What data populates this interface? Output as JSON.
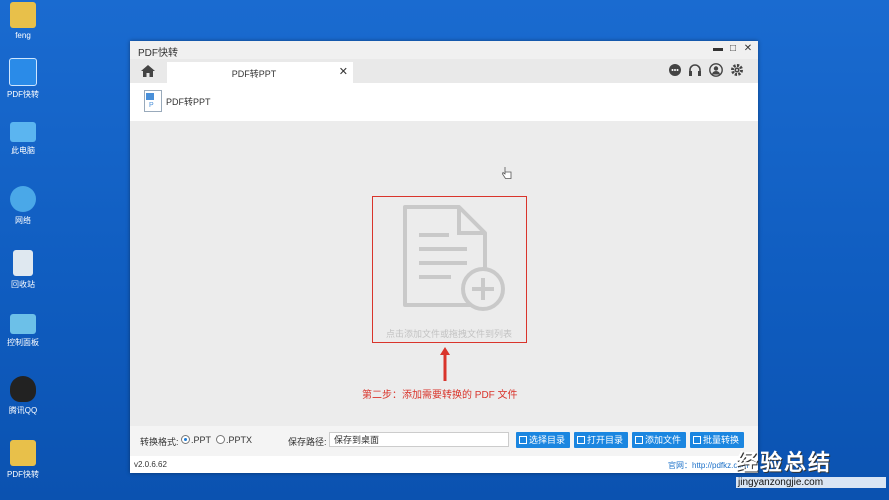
{
  "desktop": {
    "icons": [
      {
        "label": "feng",
        "icon": "user-folder-icon"
      },
      {
        "label": "PDF快转",
        "icon": "cloud-app-icon"
      },
      {
        "label": "此电脑",
        "icon": "computer-icon"
      },
      {
        "label": "网络",
        "icon": "network-icon"
      },
      {
        "label": "回收站",
        "icon": "recycle-bin-icon"
      },
      {
        "label": "控制面板",
        "icon": "control-panel-icon"
      },
      {
        "label": "腾讯QQ",
        "icon": "qq-icon"
      },
      {
        "label": "PDF快转",
        "icon": "folder-icon"
      }
    ]
  },
  "window": {
    "title": "PDF快转",
    "controls": {
      "minimize": "▬",
      "maximize": "□",
      "close": "✕"
    }
  },
  "tabbar": {
    "tab_label": "PDF转PPT",
    "tab_close": "✕"
  },
  "header": {
    "title": "PDF转PPT"
  },
  "dropzone": {
    "hint": "点击添加文件或拖拽文件到列表"
  },
  "annotation": {
    "text": "第二步：添加需要转换的 PDF 文件",
    "color": "#d9342b"
  },
  "bottom": {
    "format_label": "转换格式:",
    "option_ppt": ".PPT",
    "option_pptx": ".PPTX",
    "selected": ".PPT",
    "save_label": "保存路径:",
    "save_value": "保存到桌面",
    "buttons": {
      "choose_dir": "选择目录",
      "open_dir": "打开目录",
      "add_file": "添加文件",
      "batch_convert": "批量转换"
    }
  },
  "status": {
    "version": "v2.0.6.62",
    "site": "官网：http://pdfkz.com"
  },
  "watermark": {
    "big": "经验总结",
    "small": "jingyanzongjie.com"
  },
  "colors": {
    "accent": "#1b86e0",
    "desktop": "#1565c9"
  }
}
